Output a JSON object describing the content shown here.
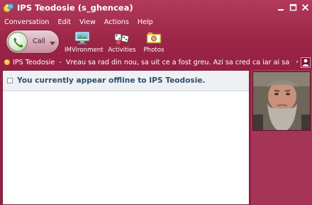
{
  "window": {
    "title": "IPS Teodosie (s_ghencea)",
    "accent_color": "#9b2447",
    "controls": [
      "minimize-icon",
      "maximize-icon",
      "close-icon"
    ]
  },
  "menu": [
    "Conversation",
    "Edit",
    "View",
    "Actions",
    "Help"
  ],
  "toolbar": {
    "call_label": "Call",
    "items": [
      {
        "label": "IMVironment",
        "icon": "imvironment-icon"
      },
      {
        "label": "Activities",
        "icon": "activities-icon"
      },
      {
        "label": "Photos",
        "icon": "photos-icon"
      }
    ]
  },
  "status": {
    "contact": "IPS Teodosie",
    "separator": "-",
    "message": "Vreau sa rad din nou, sa uit ce a fost greu. Azi sa cred ca iar ai sa te intorci.",
    "ellipsis": "...",
    "expand_glyph": "›",
    "dot_color": "#f0b400"
  },
  "conversation": {
    "notice": "You currently appear offline to IPS Teodosie."
  },
  "side": {
    "avatar": "contact-avatar-photo"
  }
}
